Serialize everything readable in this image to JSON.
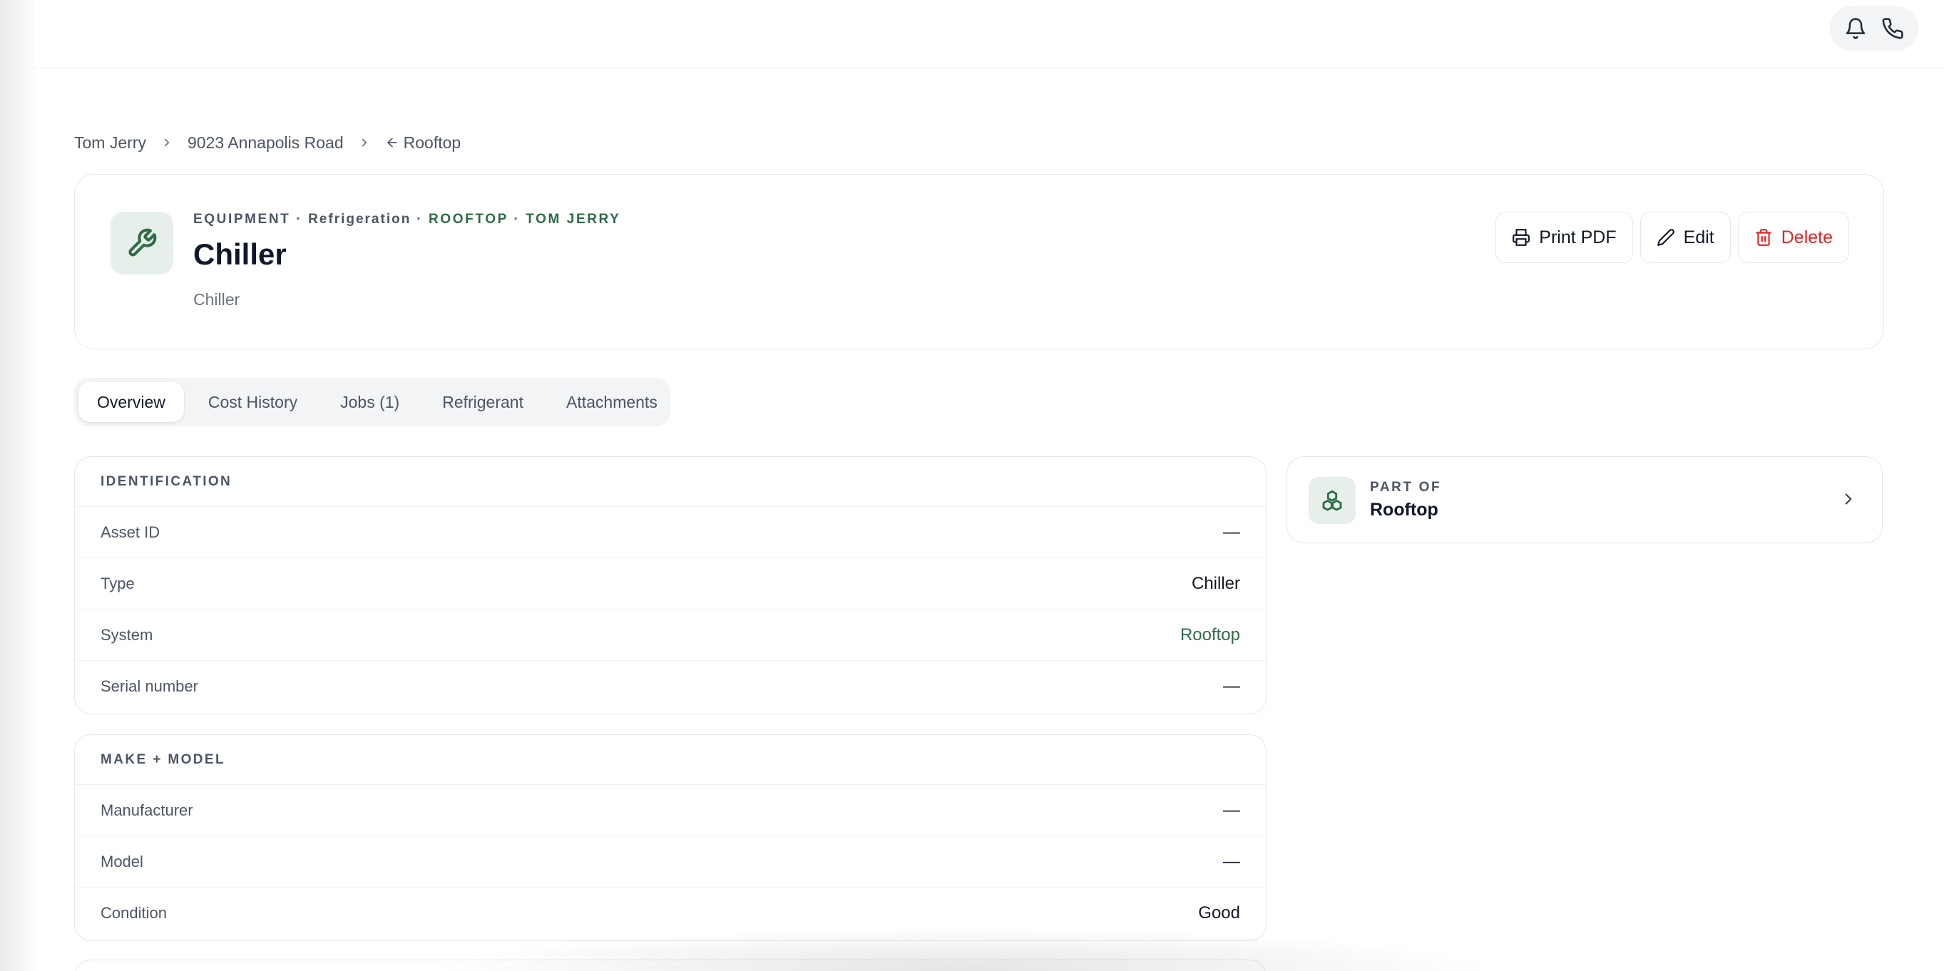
{
  "topbar": {
    "actions": [
      {
        "name": "notifications",
        "icon": "bell-icon"
      },
      {
        "name": "phone",
        "icon": "phone-icon"
      }
    ]
  },
  "breadcrumb": {
    "items": [
      "Tom Jerry",
      "9023 Annapolis Road"
    ],
    "back": "Rooftop"
  },
  "header": {
    "eyebrow_kind": "EQUIPMENT",
    "eyebrow_category": "Refrigeration",
    "eyebrow_system": "ROOFTOP",
    "eyebrow_client": "TOM JERRY",
    "separator": "·",
    "title": "Chiller",
    "subtitle": "Chiller",
    "icon": "wrench-icon",
    "actions": {
      "print": "Print PDF",
      "edit": "Edit",
      "delete": "Delete"
    }
  },
  "tabs": [
    "Overview",
    "Cost History",
    "Jobs (1)",
    "Refrigerant",
    "Attachments"
  ],
  "active_tab": "Overview",
  "identification": {
    "title": "IDENTIFICATION",
    "rows": [
      {
        "label": "Asset ID",
        "value": "—"
      },
      {
        "label": "Type",
        "value": "Chiller"
      },
      {
        "label": "System",
        "value": "Rooftop"
      },
      {
        "label": "Serial number",
        "value": "—"
      }
    ]
  },
  "make_model": {
    "title": "MAKE + MODEL",
    "rows": [
      {
        "label": "Manufacturer",
        "value": "—"
      },
      {
        "label": "Model",
        "value": "—"
      },
      {
        "label": "Condition",
        "value": "Good"
      }
    ]
  },
  "part_of": {
    "eyebrow": "PART OF",
    "title": "Rooftop",
    "icon": "system-cluster-icon"
  },
  "colors": {
    "accent": "#2f6b46",
    "danger": "#dc2626",
    "muted": "#4b5563"
  }
}
